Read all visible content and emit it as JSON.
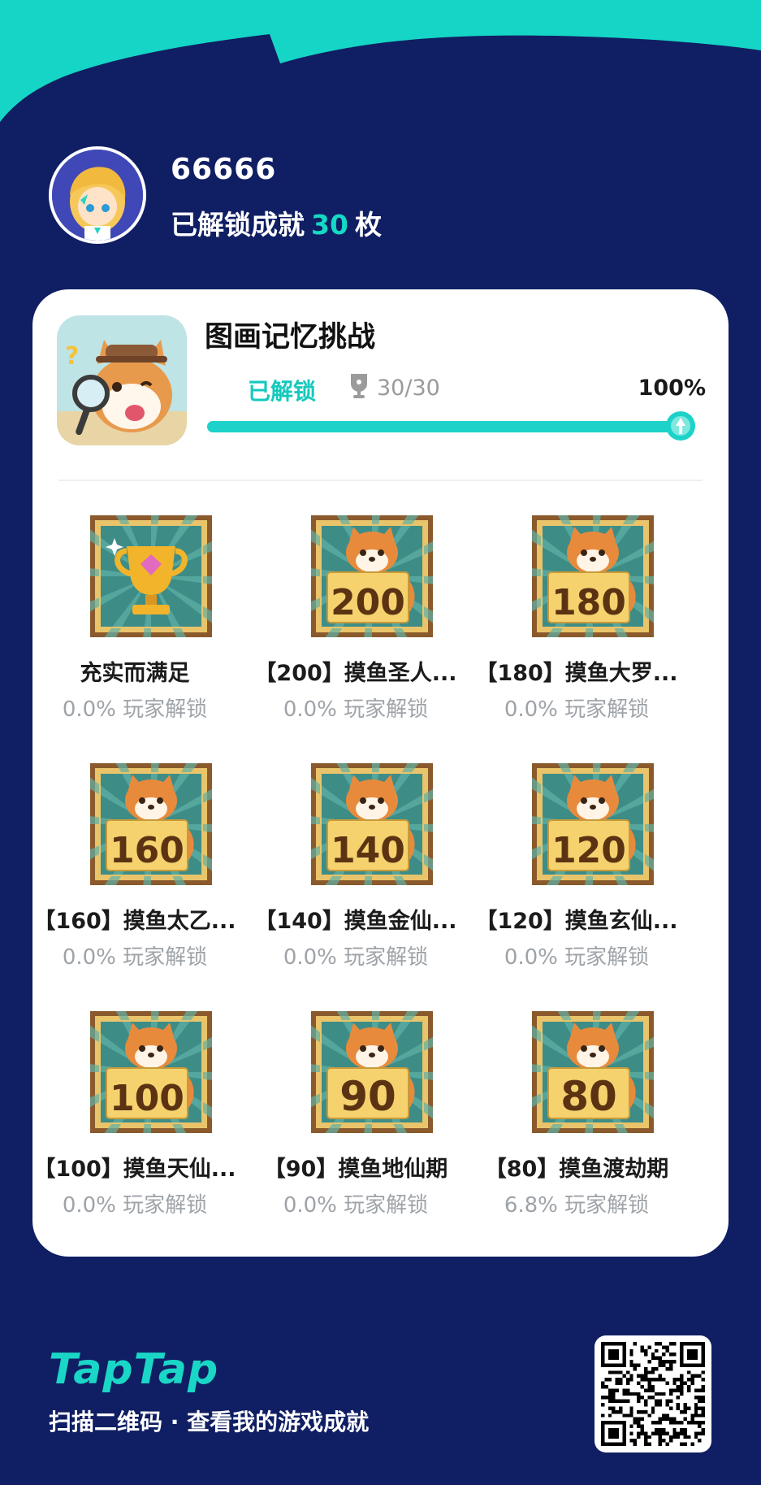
{
  "profile": {
    "username": "66666",
    "unlocked_prefix": "已解锁成就",
    "unlocked_count": "30",
    "unlocked_suffix": "枚"
  },
  "game": {
    "title": "图画记忆挑战",
    "status": "已解锁",
    "trophy_icon": "trophy-icon",
    "progress_text": "30/30",
    "percent_text": "100%",
    "progress_fraction": 1.0
  },
  "achievements": [
    {
      "name": "充实而满足",
      "rate": "0.0% 玩家解锁",
      "badge": "trophy",
      "number": ""
    },
    {
      "name": "【200】摸鱼圣人...",
      "rate": "0.0% 玩家解锁",
      "badge": "shiba",
      "number": "200"
    },
    {
      "name": "【180】摸鱼大罗...",
      "rate": "0.0% 玩家解锁",
      "badge": "shiba",
      "number": "180"
    },
    {
      "name": "【160】摸鱼太乙...",
      "rate": "0.0% 玩家解锁",
      "badge": "shiba",
      "number": "160"
    },
    {
      "name": "【140】摸鱼金仙...",
      "rate": "0.0% 玩家解锁",
      "badge": "shiba",
      "number": "140"
    },
    {
      "name": "【120】摸鱼玄仙...",
      "rate": "0.0% 玩家解锁",
      "badge": "shiba",
      "number": "120"
    },
    {
      "name": "【100】摸鱼天仙...",
      "rate": "0.0% 玩家解锁",
      "badge": "shiba",
      "number": "100"
    },
    {
      "name": "【90】摸鱼地仙期",
      "rate": "0.0% 玩家解锁",
      "badge": "shiba",
      "number": "90"
    },
    {
      "name": "【80】摸鱼渡劫期",
      "rate": "6.8% 玩家解锁",
      "badge": "shiba",
      "number": "80"
    }
  ],
  "footer": {
    "brand": "TapTap",
    "scan_text": "扫描二维码 · 查看我的游戏成就"
  },
  "colors": {
    "background": "#101f63",
    "accent": "#14d9c5",
    "card": "#ffffff"
  }
}
